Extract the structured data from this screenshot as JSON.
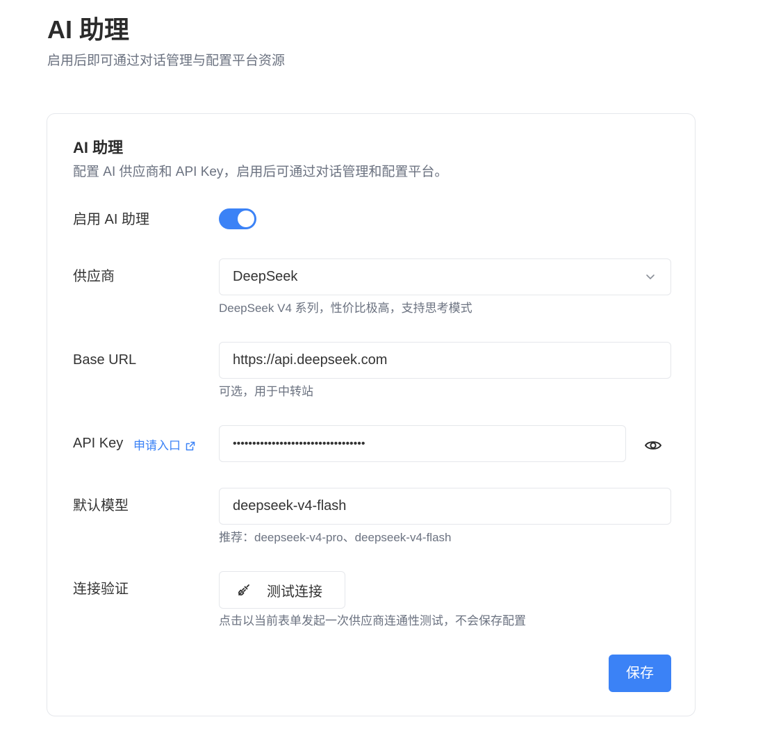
{
  "page": {
    "title": "AI 助理",
    "subtitle": "启用后即可通过对话管理与配置平台资源"
  },
  "card": {
    "title": "AI 助理",
    "description": "配置 AI 供应商和 API Key，启用后可通过对话管理和配置平台。"
  },
  "enable": {
    "label": "启用 AI 助理",
    "enabled": true
  },
  "provider": {
    "label": "供应商",
    "value": "DeepSeek",
    "hint": "DeepSeek V4 系列，性价比极高，支持思考模式",
    "icon": "chevron-down-icon"
  },
  "base_url": {
    "label": "Base URL",
    "value": "https://api.deepseek.com",
    "hint": "可选，用于中转站"
  },
  "api_key": {
    "label": "API Key",
    "apply_link": "申请入口",
    "value": "••••••••••••••••••••••••••••••••••",
    "link_icon": "external-link-icon",
    "toggle_icon": "eye-icon"
  },
  "default_model": {
    "label": "默认模型",
    "value": "deepseek-v4-flash",
    "hint": "推荐：deepseek-v4-pro、deepseek-v4-flash"
  },
  "connection": {
    "label": "连接验证",
    "button_label": "测试连接",
    "button_icon": "plug-icon",
    "hint": "点击以当前表单发起一次供应商连通性测试，不会保存配置"
  },
  "actions": {
    "save_label": "保存"
  },
  "colors": {
    "accent": "#3b82f6",
    "text": "#333333",
    "muted": "#6b7280",
    "border": "#e5e7eb"
  }
}
